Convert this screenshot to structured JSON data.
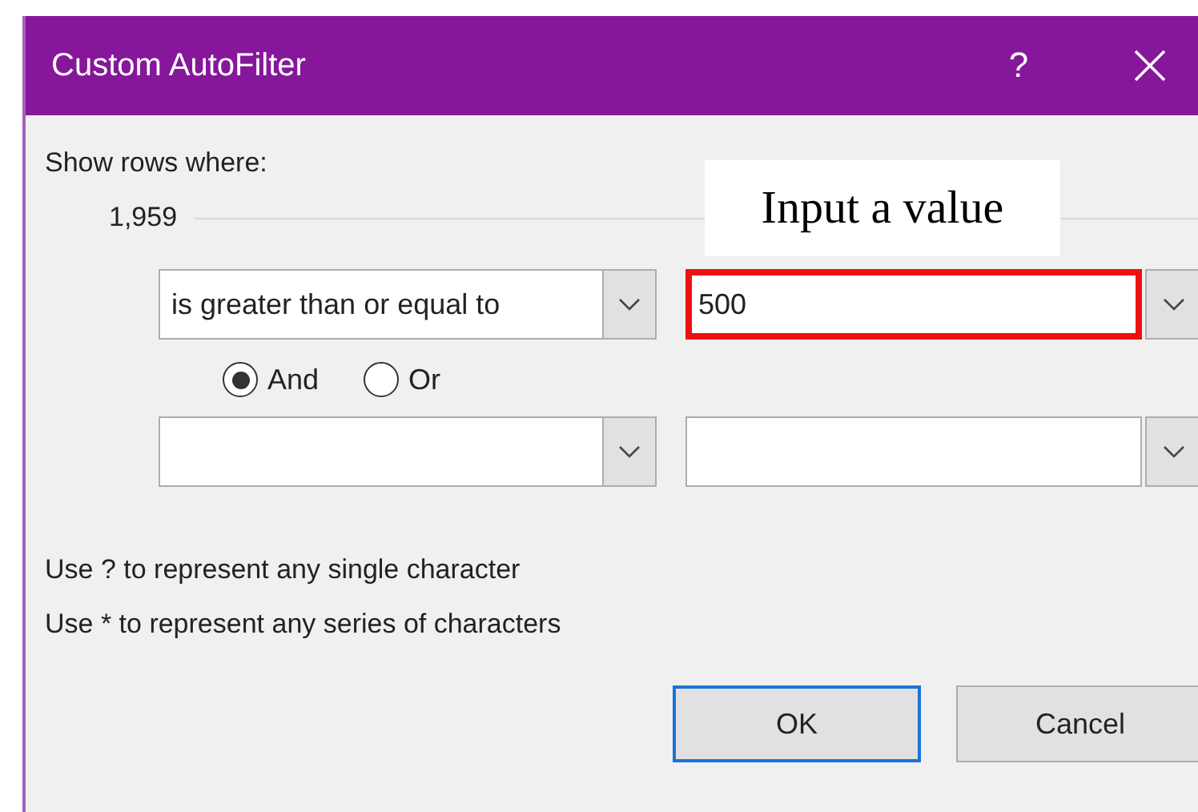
{
  "window": {
    "title": "Custom AutoFilter",
    "help": "?"
  },
  "prompt": "Show rows where:",
  "column_label": "1,959",
  "annotation": {
    "text": "Input a value"
  },
  "criteria": [
    {
      "operator": "is greater than or equal to",
      "value": "500",
      "highlighted": true
    },
    {
      "highlighted": false
    }
  ],
  "join": [
    {
      "label": "And",
      "selected": true
    },
    {
      "label": "Or",
      "selected": false
    }
  ],
  "hints": [
    "Use ? to represent any single character",
    "Use * to represent any series of characters"
  ],
  "buttons": [
    {
      "label": "OK",
      "default": true
    },
    {
      "label": "Cancel",
      "default": false
    }
  ]
}
